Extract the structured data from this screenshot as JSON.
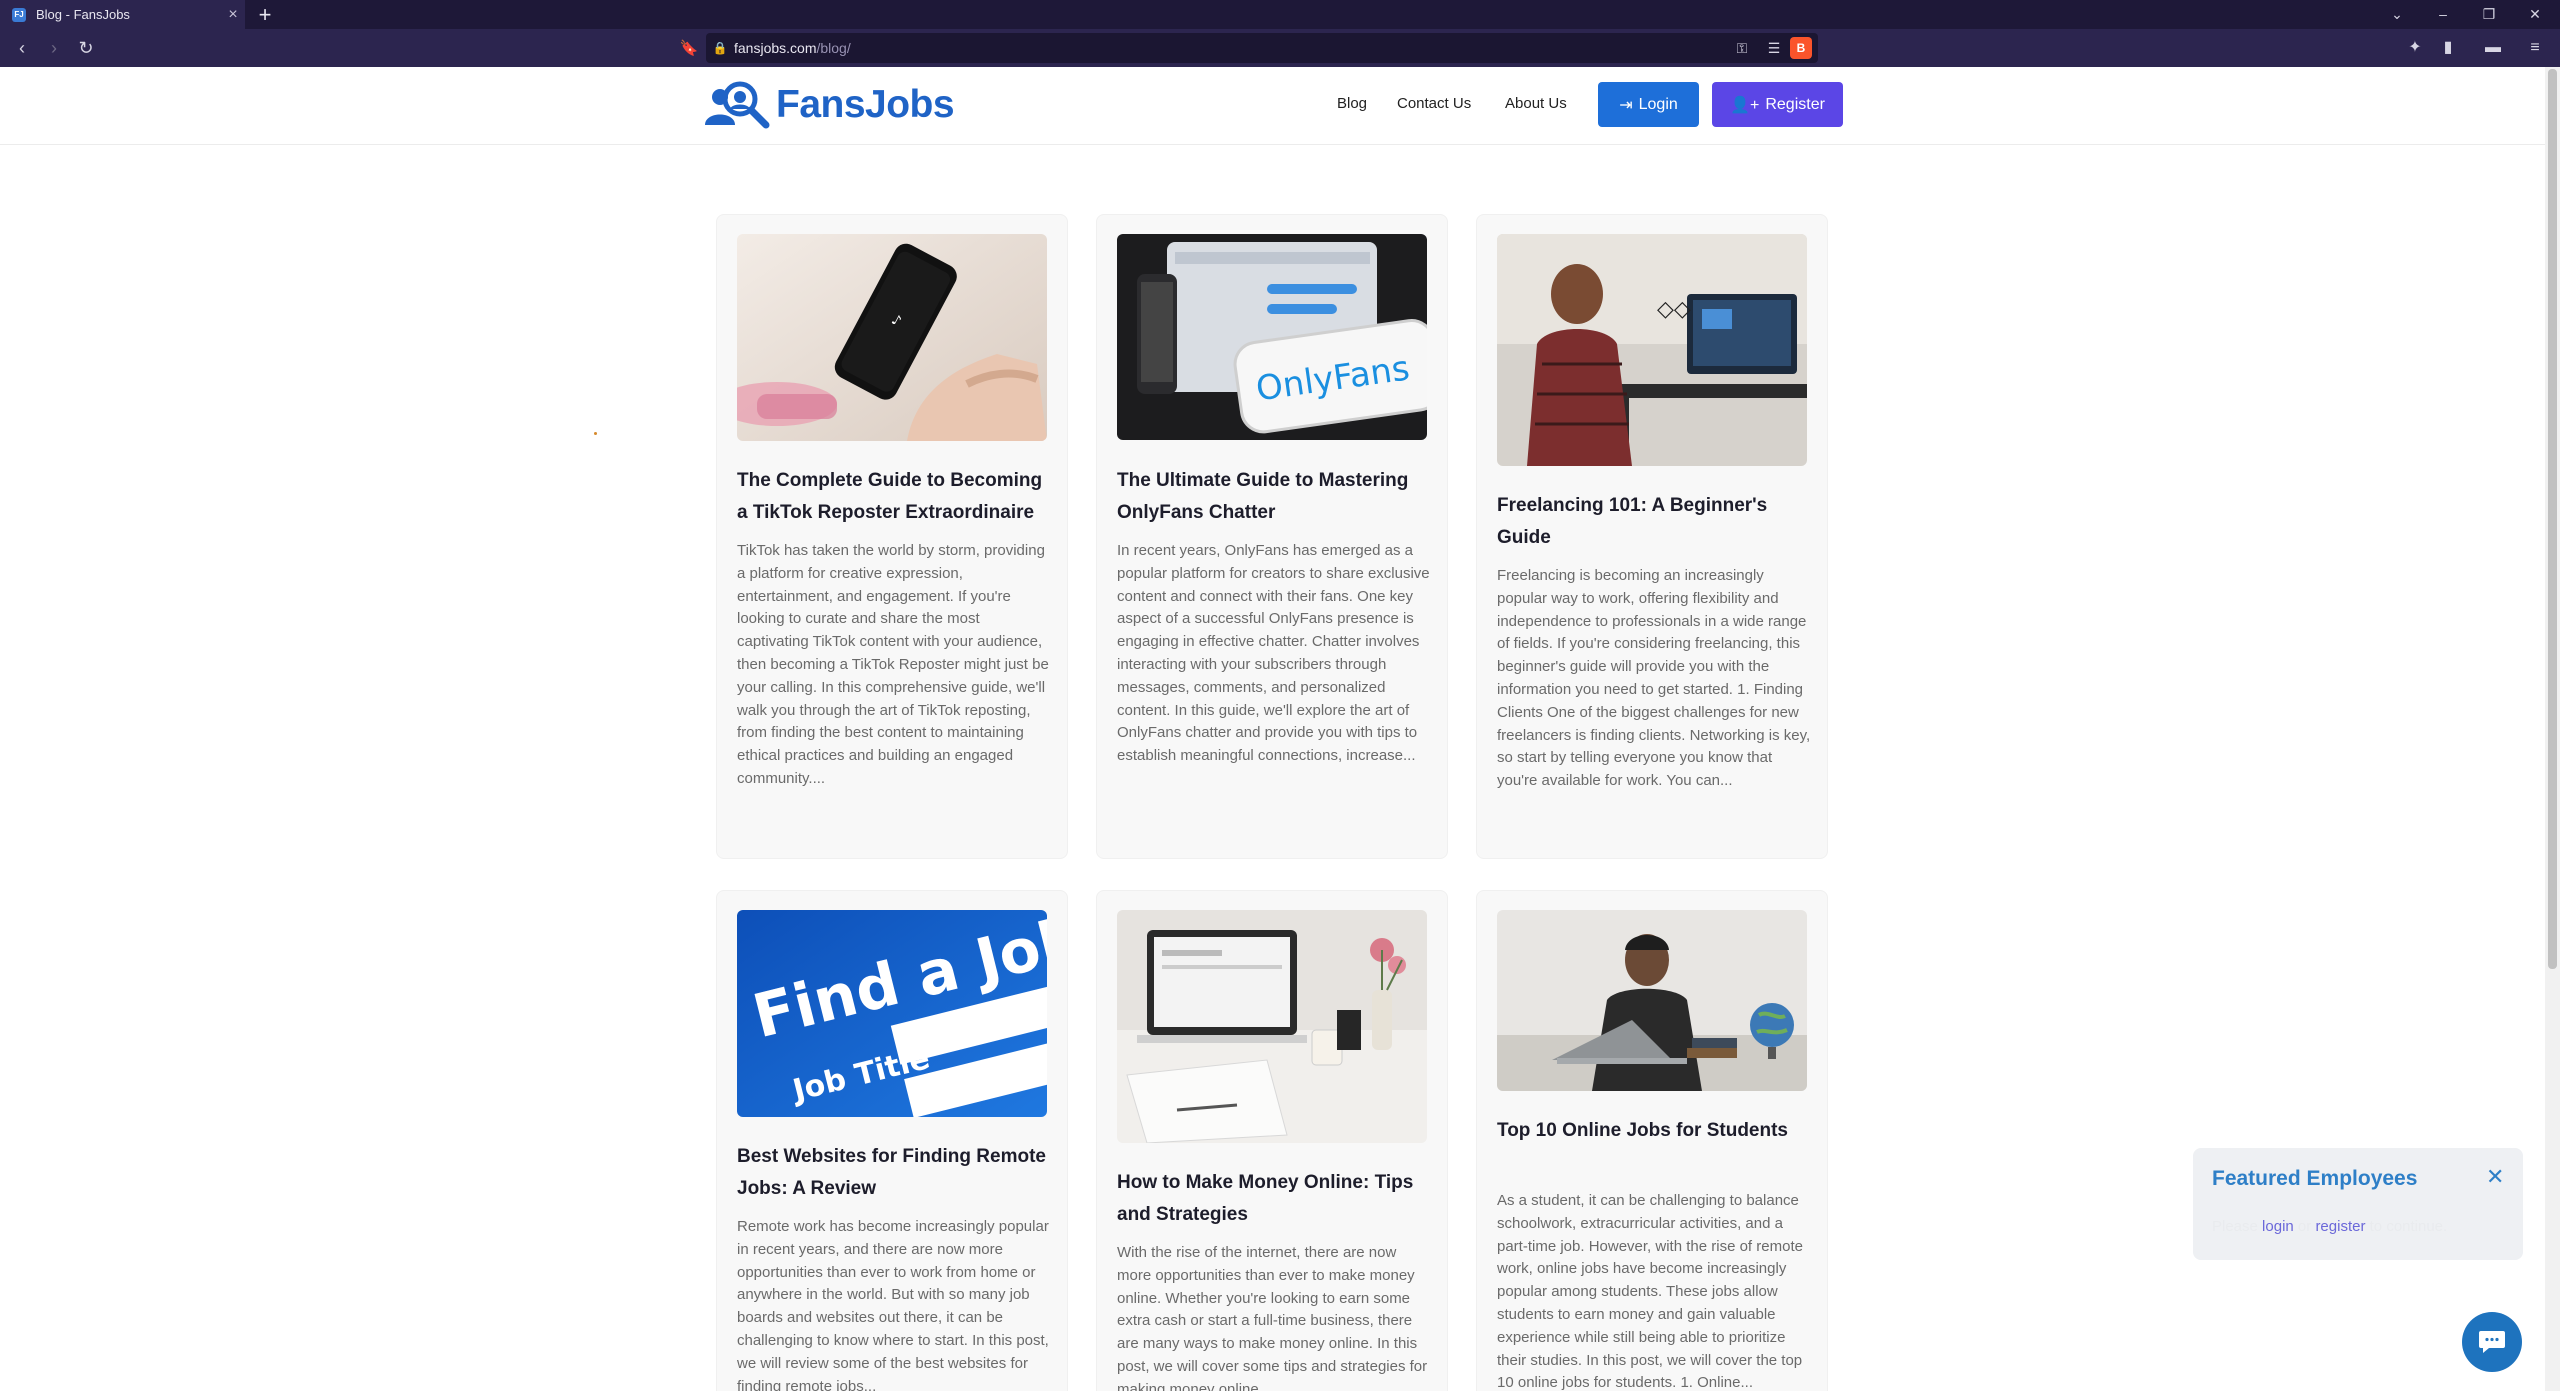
{
  "browser": {
    "tab_title": "Blog - FansJobs",
    "url_domain": "fansjobs.com",
    "url_path": "/blog/"
  },
  "header": {
    "logo_text": "FansJobs",
    "nav": [
      "Blog",
      "Contact Us",
      "About Us"
    ],
    "login_label": "Login",
    "register_label": "Register"
  },
  "posts": [
    {
      "title": "The Complete Guide to Becoming a TikTok Reposter Extraordinaire",
      "excerpt": "TikTok has taken the world by storm, providing a platform for creative expression, entertainment, and engagement. If you're looking to curate and share the most captivating TikTok content with your audience, then becoming a TikTok Reposter might just be your calling. In this comprehensive guide, we'll walk you through the art of TikTok reposting, from finding the best content to maintaining ethical practices and building an engaged community....",
      "image": "phone-tiktok"
    },
    {
      "title": "The Ultimate Guide to Mastering OnlyFans Chatter",
      "excerpt": "In recent years, OnlyFans has emerged as a popular platform for creators to share exclusive content and connect with their fans. One key aspect of a successful OnlyFans presence is engaging in effective chatter. Chatter involves interacting with your subscribers through messages, comments, and personalized content. In this guide, we'll explore the art of OnlyFans chatter and provide you with tips to establish meaningful connections, increase...",
      "image": "onlyfans-phone",
      "image_text": "OnlyFans"
    },
    {
      "title": "Freelancing 101: A Beginner's Guide",
      "excerpt": "Freelancing is becoming an increasingly popular way to work, offering flexibility and independence to professionals in a wide range of fields. If you're considering freelancing, this beginner's guide will provide you with the information you need to get started. 1. Finding Clients One of the biggest challenges for new freelancers is finding clients. Networking is key, so start by telling everyone you know that you're available for work. You can...",
      "image": "desk-workstation"
    },
    {
      "title": "Best Websites for Finding Remote Jobs: A Review",
      "excerpt": "Remote work has become increasingly popular in recent years, and there are now more opportunities than ever to work from home or anywhere in the world. But with so many job boards and websites out there, it can be challenging to know where to start. In this post, we will review some of the best websites for finding remote jobs...",
      "image": "find-a-job",
      "image_text_big": "Find a Job",
      "image_text_small": "Job Title"
    },
    {
      "title": "How to Make Money Online: Tips and Strategies",
      "excerpt": "With the rise of the internet, there are now more opportunities than ever to make money online. Whether you're looking to earn some extra cash or start a full-time business, there are many ways to make money online. In this post, we will cover some tips and strategies for making money online...",
      "image": "laptop-notebook"
    },
    {
      "title": "Top 10 Online Jobs for Students",
      "excerpt": "As a student, it can be challenging to balance schoolwork, extracurricular activities, and a part-time job. However, with the rise of remote work, online jobs have become increasingly popular among students. These jobs allow students to earn money and gain valuable experience while still being able to prioritize their studies. In this post, we will cover the top 10 online jobs for students. 1. Online...",
      "image": "student-laptop"
    }
  ],
  "featured": {
    "title": "Featured Employees",
    "msg_before": "Please ",
    "login_link": "login",
    "msg_middle": " or ",
    "register_link": "register",
    "msg_after": " to continue."
  },
  "colors": {
    "brand_blue": "#1f63c6",
    "login_btn": "#1e6fd9",
    "register_btn": "#5b46e6",
    "browser_bg": "#2c254f"
  }
}
